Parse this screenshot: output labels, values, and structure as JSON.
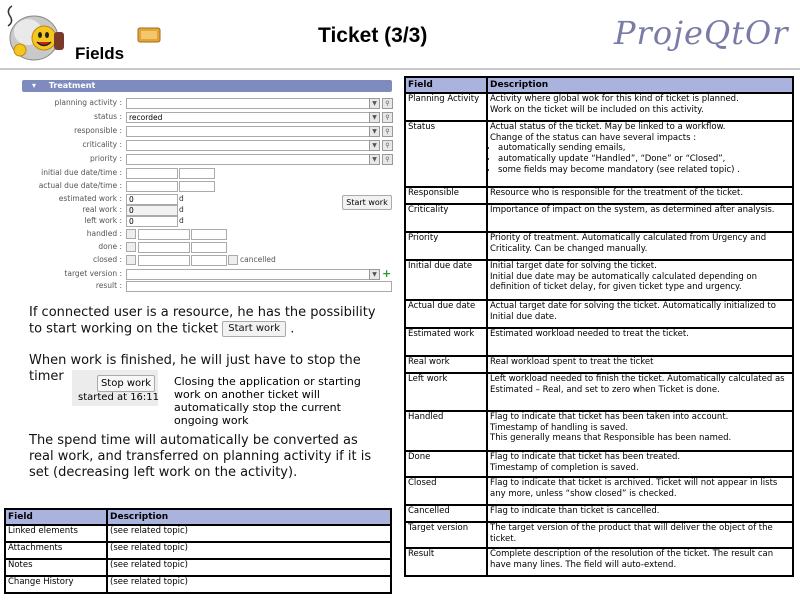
{
  "header": {
    "section": "Fields",
    "title": "Ticket (3/3)",
    "brand": "ProjeQtOr"
  },
  "form": {
    "section_title": "Treatment",
    "labels": {
      "planning_activity": "planning activity :",
      "status": "status :",
      "responsible": "responsible :",
      "criticality": "criticality :",
      "priority": "priority :",
      "initial_due": "initial due date/time :",
      "actual_due": "actual due date/time :",
      "estimated_work": "estimated work :",
      "real_work": "real work :",
      "left_work": "left work :",
      "handled": "handled :",
      "done": "done :",
      "closed": "closed :",
      "target_version": "target version :",
      "result": "result :"
    },
    "values": {
      "status": "recorded",
      "estimated_work": "0",
      "real_work": "0",
      "left_work": "0",
      "unit": "d",
      "cancelled": "cancelled"
    },
    "start_work_label": "Start work"
  },
  "body": {
    "p1": "If connected user is a resource, he has the possibility to start working on the ticket",
    "p1_button": "Start work",
    "p1_end": ".",
    "p2": "When work is finished, he will just have to stop the timer",
    "stop_button": "Stop work",
    "stop_started": "started at 16:11",
    "stop_note": "Closing the application or starting work on another ticket will automatically stop the current ongoing work",
    "p3": "The spend time will automatically be converted as real work, and transferred on planning activity if it is set (decreasing left work on the activity)."
  },
  "right_table": {
    "headers": [
      "Field",
      "Description"
    ],
    "rows": [
      {
        "field": "Planning Activity",
        "desc": [
          "Activity where global wok for this kind of ticket is planned.",
          "Work on the ticket will be included on this activity."
        ]
      },
      {
        "field": "Status",
        "desc": [
          "Actual status of the ticket. May be linked to a workflow.",
          "Change of the status can have several impacts :"
        ],
        "bullets": [
          "automatically sending emails,",
          "automatically update “Handled”, “Done” or “Closed”,",
          "some fields may become mandatory (see related topic) ."
        ]
      },
      {
        "field": "Responsible",
        "desc": [
          "Resource who is responsible for the treatment of the ticket."
        ]
      },
      {
        "field": "Criticality",
        "desc": [
          "Importance of impact on the system, as determined after analysis."
        ]
      },
      {
        "field": "Priority",
        "desc": [
          "Priority of treatment. Automatically calculated from Urgency and Criticality. Can be changed manually."
        ]
      },
      {
        "field": "Initial due date",
        "desc": [
          "Initial target date for solving the ticket.",
          "Initial due date may be automatically calculated depending on definition of ticket delay, for given ticket type and urgency."
        ]
      },
      {
        "field": "Actual due date",
        "desc": [
          "Actual target date for solving the ticket. Automatically initialized to Initial due date."
        ]
      },
      {
        "field": "Estimated work",
        "desc": [
          "Estimated workload needed to treat the ticket."
        ]
      },
      {
        "field": "Real work",
        "desc": [
          "Real workload spent to treat the ticket"
        ]
      },
      {
        "field": "Left work",
        "desc": [
          "Left workload needed to finish the ticket. Automatically calculated as Estimated – Real, and set to zero when Ticket is done."
        ]
      },
      {
        "field": "Handled",
        "desc": [
          "Flag to indicate that ticket has been taken into account.",
          "Timestamp of handling is saved.",
          "This generally means that Responsible has been named."
        ]
      },
      {
        "field": "Done",
        "desc": [
          "Flag to indicate that ticket has been treated.",
          "Timestamp of completion is saved."
        ]
      },
      {
        "field": "Closed",
        "desc": [
          "Flag to indicate that ticket is archived. Ticket will not appear in lists any more, unless “show closed” is checked."
        ]
      },
      {
        "field": "Cancelled",
        "desc": [
          "Flag to indicate than ticket is cancelled."
        ]
      },
      {
        "field": "Target version",
        "desc": [
          "The target version of the product that will deliver the object of the ticket."
        ]
      },
      {
        "field": "Result",
        "desc": [
          "Complete description of the resolution of the ticket. The result can have many lines. The field will auto-extend."
        ]
      }
    ]
  },
  "left_table": {
    "headers": [
      "Field",
      "Description"
    ],
    "rows": [
      {
        "field": "Linked elements",
        "desc": "(see related topic)"
      },
      {
        "field": "Attachments",
        "desc": "(see related topic)"
      },
      {
        "field": "Notes",
        "desc": "(see related topic)"
      },
      {
        "field": "Change History",
        "desc": "(see related topic)"
      }
    ]
  }
}
